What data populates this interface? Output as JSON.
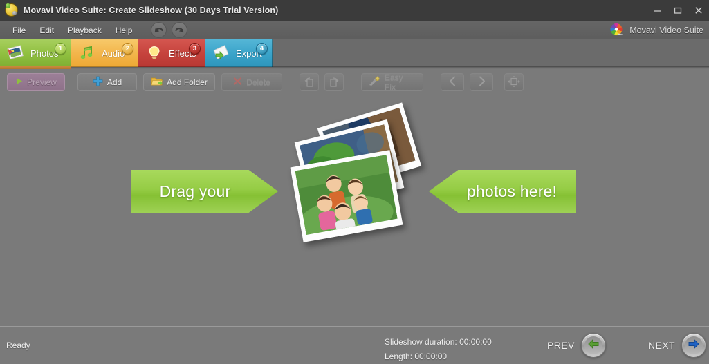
{
  "window": {
    "title": "Movavi Video Suite: Create Slideshow (30 Days Trial Version)",
    "app_icon": "movavi-ball-icon",
    "controls": {
      "minimize": "minimize-icon",
      "maximize": "maximize-icon",
      "close": "close-icon"
    }
  },
  "menubar": {
    "items": [
      {
        "label": "File"
      },
      {
        "label": "Edit"
      },
      {
        "label": "Playback"
      },
      {
        "label": "Help"
      }
    ],
    "undo": "undo-icon",
    "redo": "redo-icon",
    "brand": {
      "label": "Movavi Video Suite",
      "logo": "movavi-pinwheel-logo"
    }
  },
  "tabs": [
    {
      "label": "Photos",
      "badge": "1",
      "icon": "photos-icon",
      "active": true,
      "color": "#8fbf3f"
    },
    {
      "label": "Audio",
      "badge": "2",
      "icon": "audio-note-icon",
      "active": false,
      "color": "#f2b449"
    },
    {
      "label": "Effects",
      "badge": "3",
      "icon": "lightbulb-icon",
      "active": false,
      "color": "#c5423c"
    },
    {
      "label": "Export",
      "badge": "4",
      "icon": "export-icon",
      "active": false,
      "color": "#39a3c9"
    }
  ],
  "toolbar": {
    "preview": {
      "label": "Preview",
      "icon": "play-icon",
      "disabled": true
    },
    "add": {
      "label": "Add",
      "icon": "plus-icon",
      "disabled": false
    },
    "add_folder": {
      "label": "Add Folder",
      "icon": "folder-icon",
      "disabled": false
    },
    "delete": {
      "label": "Delete",
      "icon": "red-x-icon",
      "disabled": true
    },
    "rotate_left": {
      "icon": "rotate-left-icon",
      "disabled": true
    },
    "rotate_right": {
      "icon": "rotate-right-icon",
      "disabled": true
    },
    "easy_fix": {
      "label": "Easy Fix",
      "icon": "magic-wand-icon",
      "disabled": true
    },
    "prev": {
      "icon": "chevron-left-icon",
      "disabled": true
    },
    "next": {
      "icon": "chevron-right-icon",
      "disabled": true
    },
    "fit": {
      "icon": "fit-to-screen-icon",
      "disabled": true
    }
  },
  "canvas": {
    "drop_left_text": "Drag your",
    "drop_right_text": "photos here!",
    "illustration": "photo-stack-illustration"
  },
  "statusbar": {
    "status": "Ready",
    "slideshow_duration": "Slideshow duration: 00:00:00",
    "length": "Length: 00:00:00",
    "prev_label": "PREV",
    "next_label": "NEXT",
    "prev_icon": "arrow-left-icon",
    "next_icon": "arrow-right-icon",
    "prev_color": "#5a9e34",
    "next_color": "#1f62c4"
  }
}
